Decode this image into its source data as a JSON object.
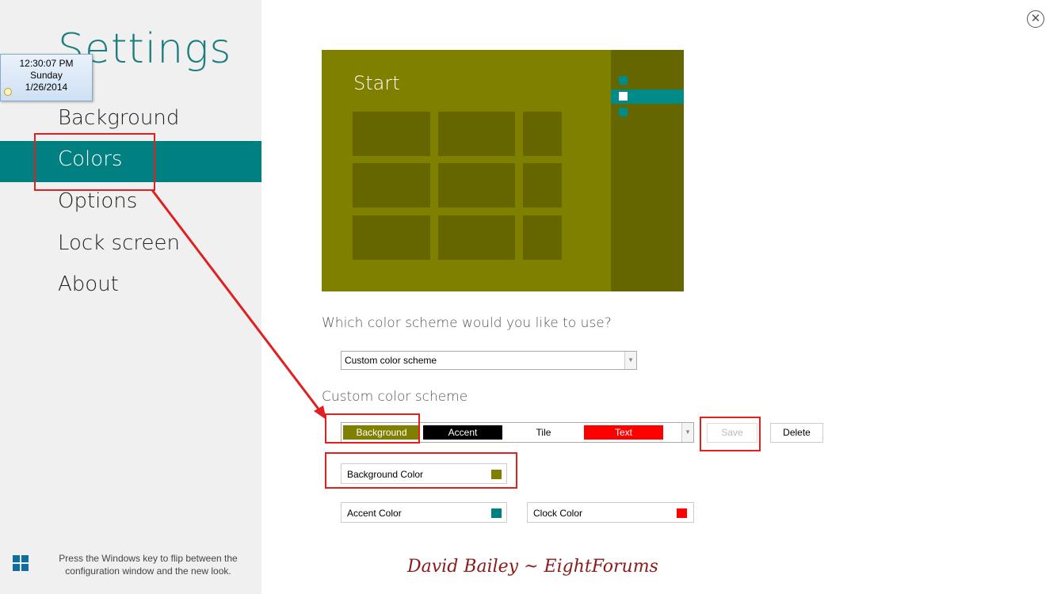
{
  "sidebar": {
    "title": "Settings",
    "items": [
      {
        "label": "Background"
      },
      {
        "label": "Colors"
      },
      {
        "label": "Options"
      },
      {
        "label": "Lock screen"
      },
      {
        "label": "About"
      }
    ],
    "hint": "Press the Windows key to flip between the configuration window and the new look."
  },
  "clock": {
    "time": "12:30:07 PM",
    "day": "Sunday",
    "date": "1/26/2014"
  },
  "preview": {
    "title": "Start",
    "background_color": "#808000",
    "accent_color": "#008080"
  },
  "main": {
    "question": "Which color scheme would you like to use?",
    "scheme_select": {
      "value": "Custom color scheme"
    },
    "section_title": "Custom color scheme",
    "scheme_items": [
      {
        "label": "Background",
        "bg": "#808000",
        "fg": "#ffffff"
      },
      {
        "label": "Accent",
        "bg": "#000000",
        "fg": "#ffffff"
      },
      {
        "label": "Tile",
        "bg": "#ffffff",
        "fg": "#000000"
      },
      {
        "label": "Text",
        "bg": "#ff0000",
        "fg": "#ffffff"
      }
    ],
    "save_label": "Save",
    "delete_label": "Delete",
    "color_fields": {
      "background": {
        "label": "Background Color",
        "color": "#808000"
      },
      "accent": {
        "label": "Accent Color",
        "color": "#008080"
      },
      "clock": {
        "label": "Clock Color",
        "color": "#ff0000"
      }
    }
  },
  "signature": "David Bailey ~ EightForums"
}
